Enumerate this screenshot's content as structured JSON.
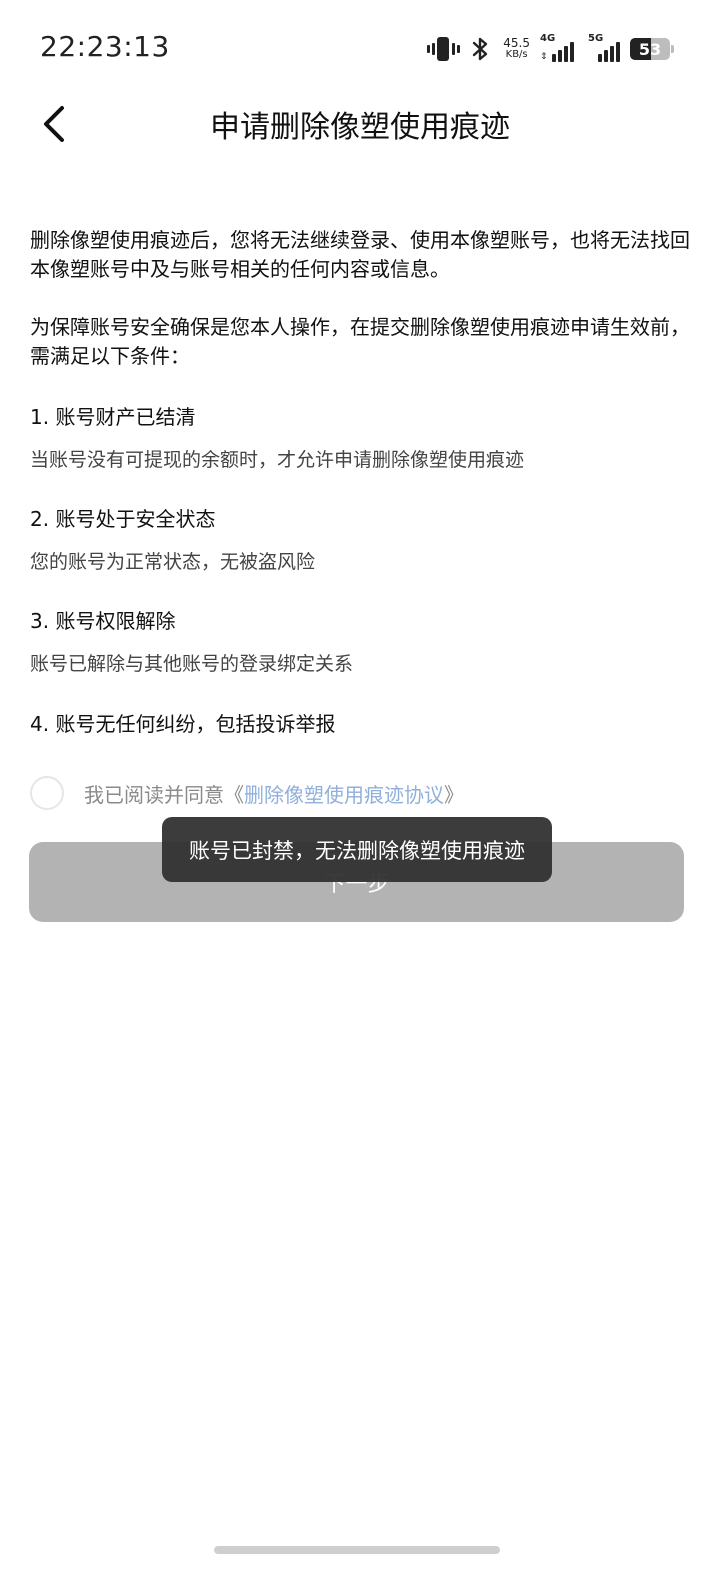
{
  "status_bar": {
    "time": "22:23:13",
    "net_speed_value": "45.5",
    "net_speed_unit": "KB/s",
    "signal_1_label": "4G",
    "signal_2_label": "5G",
    "battery_level": "53",
    "icons": [
      "vibrate-icon",
      "bluetooth-icon",
      "signal-4g-icon",
      "signal-5g-icon",
      "battery-icon"
    ]
  },
  "nav": {
    "back_icon": "chevron-left-icon",
    "title": "申请删除像塑使用痕迹"
  },
  "content": {
    "intro_1": "删除像塑使用痕迹后，您将无法继续登录、使用本像塑账号，也将无法找回本像塑账号中及与账号相关的任何内容或信息。",
    "intro_2": "为保障账号安全确保是您本人操作，在提交删除像塑使用痕迹申请生效前，需满足以下条件：",
    "conditions": [
      {
        "title": "1. 账号财产已结清",
        "desc": "当账号没有可提现的余额时，才允许申请删除像塑使用痕迹"
      },
      {
        "title": "2. 账号处于安全状态",
        "desc": "您的账号为正常状态，无被盗风险"
      },
      {
        "title": "3. 账号权限解除",
        "desc": "账号已解除与其他账号的登录绑定关系"
      },
      {
        "title": "4. 账号无任何纠纷，包括投诉举报",
        "desc": ""
      }
    ]
  },
  "agreement": {
    "prefix": "我已阅读并同意《",
    "link": "删除像塑使用痕迹协议",
    "suffix": "》",
    "checked": false
  },
  "next_button": {
    "label": "下一步"
  },
  "toast": {
    "message": "账号已封禁，无法删除像塑使用痕迹"
  },
  "colors": {
    "link": "#8fb0dc",
    "button_disabled": "#b3b3b3",
    "toast_bg": "#323232"
  }
}
